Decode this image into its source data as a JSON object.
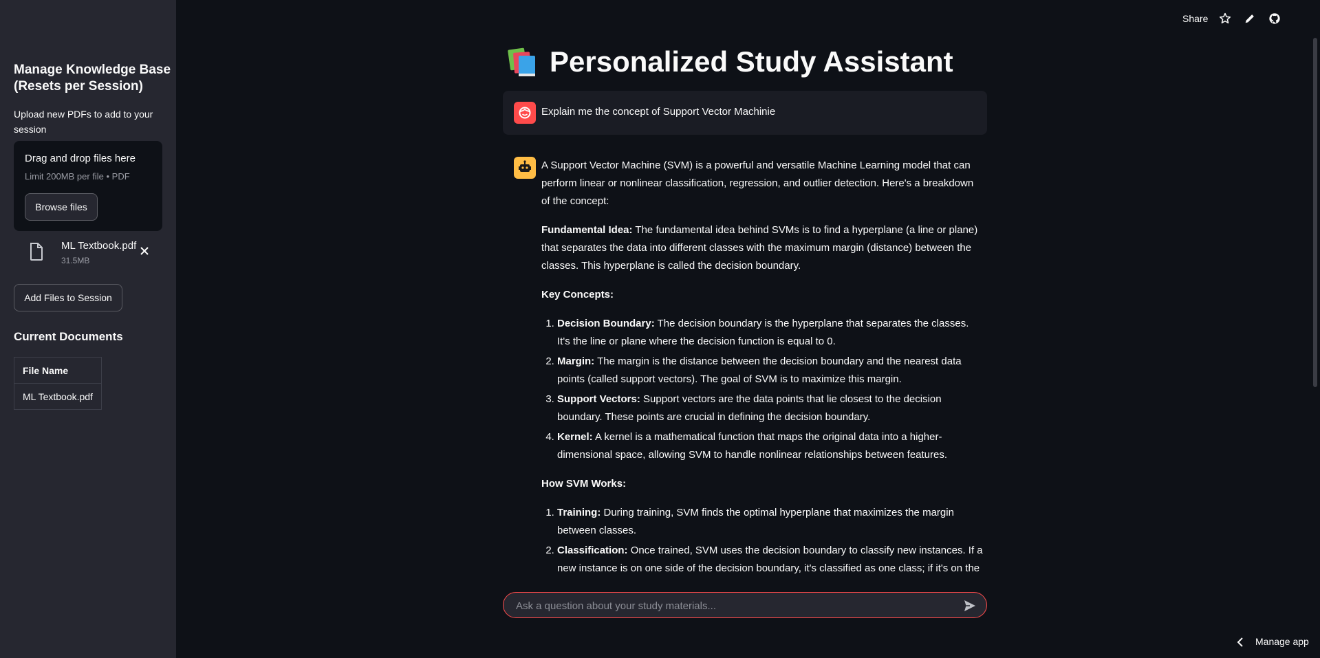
{
  "sidebar": {
    "title": "Manage Knowledge Base (Resets per Session)",
    "upload_caption": "Upload new PDFs to add to your session",
    "dropzone": {
      "title": "Drag and drop files here",
      "limit": "Limit 200MB per file • PDF",
      "browse_label": "Browse files"
    },
    "uploaded_file": {
      "name": "ML Textbook.pdf",
      "size": "31.5MB"
    },
    "add_button": "Add Files to Session",
    "current_docs_title": "Current Documents",
    "table": {
      "header": "File Name",
      "rows": [
        "ML Textbook.pdf"
      ]
    }
  },
  "topbar": {
    "share": "Share",
    "icons": [
      "star-icon",
      "pencil-icon",
      "github-icon"
    ]
  },
  "main": {
    "title": "Personalized Study Assistant",
    "title_icon": "books-emoji",
    "user_message": "Explain me the concept of Support Vector Machinie",
    "assistant": {
      "intro": "A Support Vector Machine (SVM) is a powerful and versatile Machine Learning model that can perform linear or nonlinear classification, regression, and outlier detection. Here's a breakdown of the concept:",
      "fundamental_label": "Fundamental Idea:",
      "fundamental_text": " The fundamental idea behind SVMs is to find a hyperplane (a line or plane) that separates the data into different classes with the maximum margin (distance) between the classes. This hyperplane is called the decision boundary.",
      "key_heading": "Key Concepts:",
      "key_items": [
        {
          "label": "Decision Boundary:",
          "text": " The decision boundary is the hyperplane that separates the classes. It's the line or plane where the decision function is equal to 0."
        },
        {
          "label": "Margin:",
          "text": " The margin is the distance between the decision boundary and the nearest data points (called support vectors). The goal of SVM is to maximize this margin."
        },
        {
          "label": "Support Vectors:",
          "text": " Support vectors are the data points that lie closest to the decision boundary. These points are crucial in defining the decision boundary."
        },
        {
          "label": "Kernel:",
          "text": " A kernel is a mathematical function that maps the original data into a higher-dimensional space, allowing SVM to handle nonlinear relationships between features."
        }
      ],
      "how_heading": "How SVM Works:",
      "how_items": [
        {
          "label": "Training:",
          "text": " During training, SVM finds the optimal hyperplane that maximizes the margin between classes."
        },
        {
          "label": "Classification:",
          "text": " Once trained, SVM uses the decision boundary to classify new instances. If a new instance is on one side of the decision boundary, it's classified as one class; if it's on the other side, it's classified as another class."
        }
      ]
    },
    "chat_placeholder": "Ask a question about your study materials..."
  },
  "footer": {
    "manage_app": "Manage app"
  },
  "colors": {
    "background": "#0e1117",
    "sidebar": "#262730",
    "accent": "#ff4b4b",
    "bot_avatar": "#ffbd45"
  }
}
